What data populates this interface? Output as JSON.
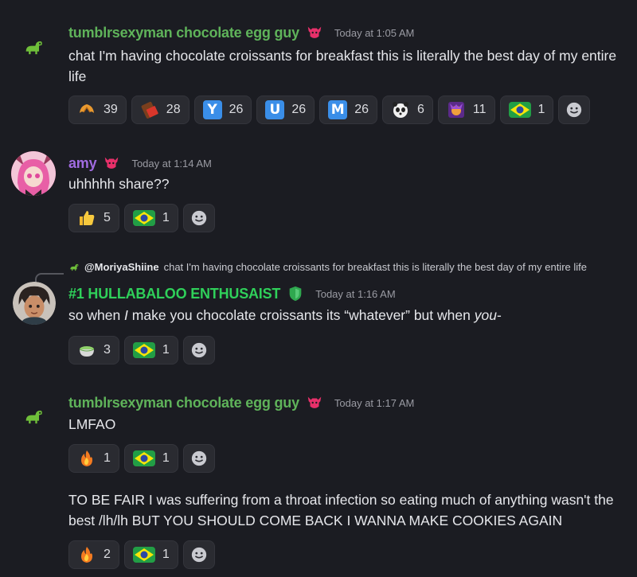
{
  "messages": [
    {
      "username": "tumblrsexyman chocolate egg guy",
      "timestamp": "Today at 1:05 AM",
      "text": "chat I'm having chocolate croissants for breakfast this is literally the best day of my entire life",
      "reactions": [
        {
          "icon": "croissant-icon",
          "count": "39"
        },
        {
          "icon": "chocolate-bar-icon",
          "count": "28"
        },
        {
          "icon": "letter-y-icon",
          "letter": "Y",
          "count": "26"
        },
        {
          "icon": "letter-u-icon",
          "letter": "U",
          "count": "26"
        },
        {
          "icon": "letter-m-icon",
          "letter": "M",
          "count": "26"
        },
        {
          "icon": "panda-face-icon",
          "count": "6"
        },
        {
          "icon": "purple-character-icon",
          "count": "11"
        },
        {
          "icon": "brazil-flag-icon",
          "count": "1"
        }
      ]
    },
    {
      "username": "amy",
      "timestamp": "Today at 1:14 AM",
      "text": "uhhhhh share??",
      "reactions": [
        {
          "icon": "thumbs-up-icon",
          "count": "5"
        },
        {
          "icon": "brazil-flag-icon",
          "count": "1"
        }
      ]
    },
    {
      "reply_to": "@MoriyaShiine",
      "reply_text": "chat I'm having chocolate croissants for breakfast this is literally the best day of my entire life",
      "username": "#1 HULLABALOO ENTHUSAIST",
      "timestamp": "Today at 1:16 AM",
      "text_before": "so when ",
      "text_em1": "I",
      "text_middle": " make you chocolate croissants its “whatever” but when ",
      "text_em2": "you",
      "text_after": "-",
      "reactions": [
        {
          "icon": "matcha-bowl-icon",
          "count": "3"
        },
        {
          "icon": "brazil-flag-icon",
          "count": "1"
        }
      ]
    },
    {
      "username": "tumblrsexyman chocolate egg guy",
      "timestamp": "Today at 1:17 AM",
      "text": "LMFAO",
      "reactions": [
        {
          "icon": "fire-icon",
          "count": "1"
        },
        {
          "icon": "brazil-flag-icon",
          "count": "1"
        }
      ],
      "text2": "TO BE FAIR I was suffering from a throat infection so eating much of anything wasn't the best /lh/lh BUT YOU SHOULD COME BACK I WANNA MAKE COOKIES AGAIN",
      "reactions2": [
        {
          "icon": "fire-icon",
          "count": "2"
        },
        {
          "icon": "brazil-flag-icon",
          "count": "1"
        }
      ]
    }
  ],
  "colors": {
    "background": "#1b1c22",
    "green_name": "#5fb35a",
    "amy_name": "#a06be0",
    "hullabaloo_name": "#2fd05a",
    "reaction_bg": "#2a2b31"
  }
}
